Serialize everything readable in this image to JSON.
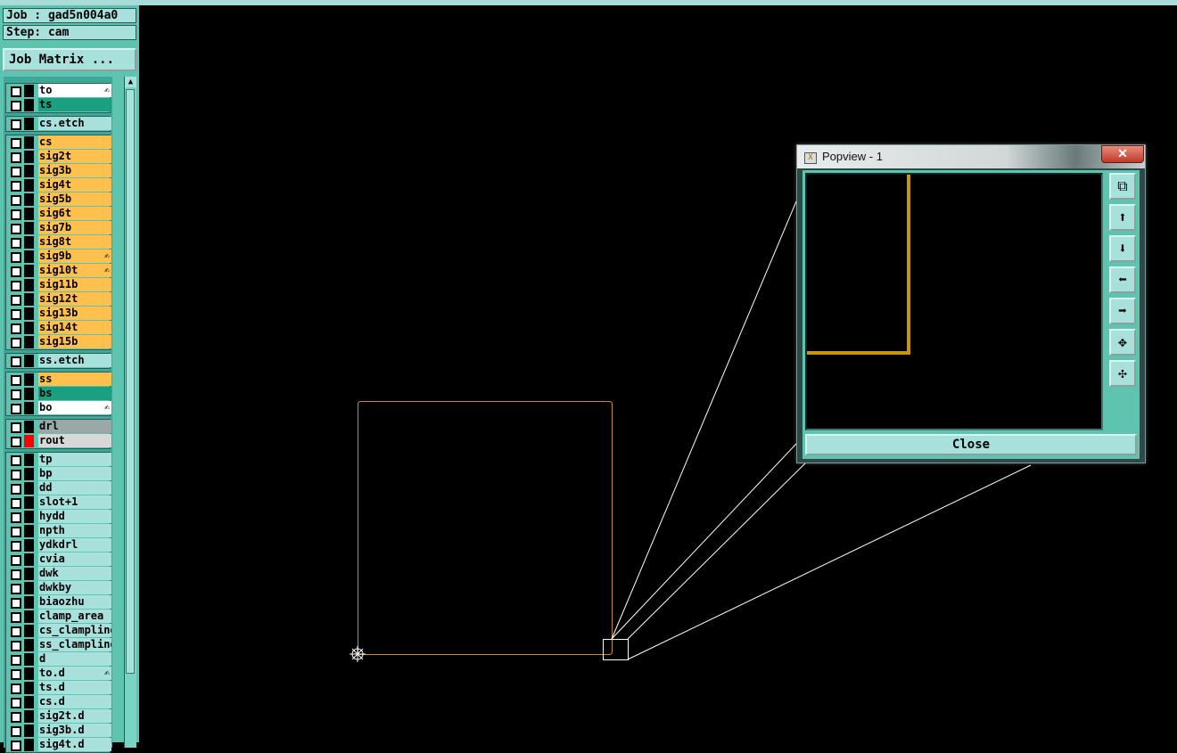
{
  "colors": {
    "signal": "#ffc04d",
    "teal_dark": "#1aa080",
    "cyan_light": "#a8e0dc",
    "white": "#ffffff",
    "grey_drl": "#9aa8a8",
    "grey_rout": "#d8d8d8",
    "red_mark": "#ff0000",
    "profile": "#c88a30",
    "trace": "#c8960a"
  },
  "header": {
    "job": "Job : gad5n004a0",
    "step": "Step: cam",
    "job_matrix_button": "Job Matrix ..."
  },
  "layers": [
    {
      "name": "to",
      "color": "white",
      "edit": true
    },
    {
      "name": "ts",
      "color": "teal_dark",
      "edit": false
    },
    {
      "name": "cs.etch",
      "color": "cyan_light",
      "edit": false
    },
    {
      "name": "cs",
      "color": "signal",
      "edit": false
    },
    {
      "name": "sig2t",
      "color": "signal",
      "edit": false
    },
    {
      "name": "sig3b",
      "color": "signal",
      "edit": false
    },
    {
      "name": "sig4t",
      "color": "signal",
      "edit": false
    },
    {
      "name": "sig5b",
      "color": "signal",
      "edit": false
    },
    {
      "name": "sig6t",
      "color": "signal",
      "edit": false
    },
    {
      "name": "sig7b",
      "color": "signal",
      "edit": false
    },
    {
      "name": "sig8t",
      "color": "signal",
      "edit": false
    },
    {
      "name": "sig9b",
      "color": "signal",
      "edit": true
    },
    {
      "name": "sig10t",
      "color": "signal",
      "edit": true
    },
    {
      "name": "sig11b",
      "color": "signal",
      "edit": false
    },
    {
      "name": "sig12t",
      "color": "signal",
      "edit": false
    },
    {
      "name": "sig13b",
      "color": "signal",
      "edit": false
    },
    {
      "name": "sig14t",
      "color": "signal",
      "edit": false
    },
    {
      "name": "sig15b",
      "color": "signal",
      "edit": false
    },
    {
      "name": "ss.etch",
      "color": "cyan_light",
      "edit": false
    },
    {
      "name": "ss",
      "color": "signal",
      "edit": false
    },
    {
      "name": "bs",
      "color": "teal_dark",
      "edit": false
    },
    {
      "name": "bo",
      "color": "white",
      "edit": true
    },
    {
      "name": "drl",
      "color": "grey_drl",
      "edit": false
    },
    {
      "name": "rout",
      "color": "grey_rout",
      "edit": false,
      "mark": "red_mark"
    },
    {
      "name": "tp",
      "color": "cyan_light",
      "edit": false
    },
    {
      "name": "bp",
      "color": "cyan_light",
      "edit": false
    },
    {
      "name": "dd",
      "color": "cyan_light",
      "edit": false
    },
    {
      "name": "slot+1",
      "color": "cyan_light",
      "edit": false
    },
    {
      "name": "hydd",
      "color": "cyan_light",
      "edit": false
    },
    {
      "name": "npth",
      "color": "cyan_light",
      "edit": false
    },
    {
      "name": "ydkdrl",
      "color": "cyan_light",
      "edit": false
    },
    {
      "name": "cvia",
      "color": "cyan_light",
      "edit": false
    },
    {
      "name": "dwk",
      "color": "cyan_light",
      "edit": false
    },
    {
      "name": "dwkby",
      "color": "cyan_light",
      "edit": false
    },
    {
      "name": "biaozhu",
      "color": "cyan_light",
      "edit": false
    },
    {
      "name": "clamp_area",
      "color": "cyan_light",
      "edit": false
    },
    {
      "name": "cs_clampline",
      "color": "cyan_light",
      "edit": false
    },
    {
      "name": "ss_clampline",
      "color": "cyan_light",
      "edit": false
    },
    {
      "name": "d",
      "color": "cyan_light",
      "edit": false
    },
    {
      "name": "to.d",
      "color": "cyan_light",
      "edit": true
    },
    {
      "name": "ts.d",
      "color": "cyan_light",
      "edit": false
    },
    {
      "name": "cs.d",
      "color": "cyan_light",
      "edit": false
    },
    {
      "name": "sig2t.d",
      "color": "cyan_light",
      "edit": false
    },
    {
      "name": "sig3b.d",
      "color": "cyan_light",
      "edit": false
    },
    {
      "name": "sig4t.d",
      "color": "cyan_light",
      "edit": false
    }
  ],
  "popview": {
    "title": "Popview - 1",
    "close_x": "✕",
    "close_button": "Close",
    "tools": [
      "zoom-fit-icon",
      "pan-up-icon",
      "pan-down-icon",
      "pan-left-icon",
      "pan-right-icon",
      "zoom-in-icon",
      "zoom-out-icon"
    ]
  }
}
